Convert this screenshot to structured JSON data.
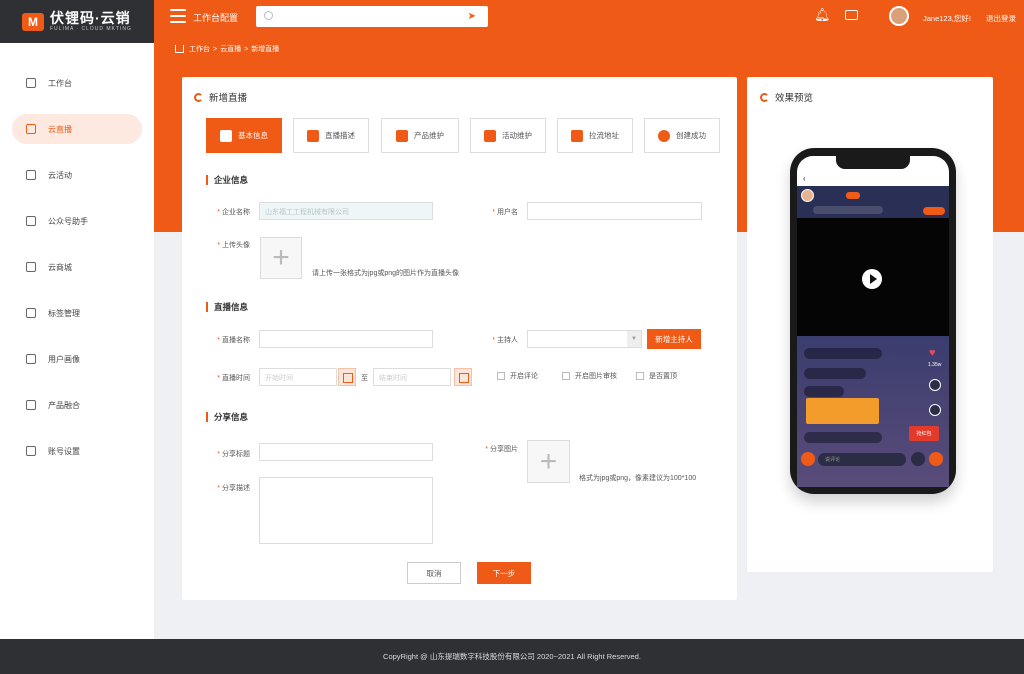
{
  "brand": {
    "name": "伏锂码·云销",
    "tagline": "FULIMA · CLOUD MKTING"
  },
  "header": {
    "title": "工作台配置",
    "user_greeting": "Jane123,您好!",
    "logout": "退出登录"
  },
  "breadcrumb": [
    "工作台",
    ">",
    "云直播",
    ">",
    "新增直播"
  ],
  "sidebar": {
    "items": [
      {
        "label": "工作台"
      },
      {
        "label": "云直播"
      },
      {
        "label": "云活动"
      },
      {
        "label": "公众号助手"
      },
      {
        "label": "云商城"
      },
      {
        "label": "标签管理"
      },
      {
        "label": "用户画像"
      },
      {
        "label": "产品融合"
      },
      {
        "label": "账号设置"
      }
    ]
  },
  "form": {
    "title": "新增直播",
    "steps": [
      "基本信息",
      "直播描述",
      "产品维护",
      "活动维护",
      "拉流地址",
      "创建成功"
    ],
    "sections": {
      "company": "企业信息",
      "live": "直播信息",
      "share": "分享信息"
    },
    "fields": {
      "company_name": {
        "label": "企业名称",
        "value": "山东福工工程机械有限公司"
      },
      "username": {
        "label": "用户名"
      },
      "avatar": {
        "label": "上传头像",
        "hint": "请上传一张格式为jpg或png的图片作为直播头像"
      },
      "live_name": {
        "label": "直播名称"
      },
      "host": {
        "label": "主持人",
        "add_button": "新增主持人"
      },
      "live_time": {
        "label": "直播时间",
        "start_placeholder": "开始时间",
        "to": "至",
        "end_placeholder": "结束时间"
      },
      "options": [
        "开启评论",
        "开启图片审核",
        "是否置顶"
      ],
      "share_title": {
        "label": "分享标题"
      },
      "share_image": {
        "label": "分享图片",
        "hint": "格式为jpg或png，像素建议为100*100"
      },
      "share_desc": {
        "label": "分享描述"
      }
    },
    "buttons": {
      "cancel": "取消",
      "next": "下一步"
    }
  },
  "preview": {
    "title": "效果预览",
    "comment_placeholder": "说评论",
    "red_packet": "抢红包",
    "likes": "1.35w"
  },
  "footer": {
    "copyright": "CopyRight @ 山东提瑞数字科技股份有限公司 2020~2021 All Right Reserved."
  },
  "colors": {
    "accent": "#ef5a16",
    "dark": "#2e3034"
  }
}
